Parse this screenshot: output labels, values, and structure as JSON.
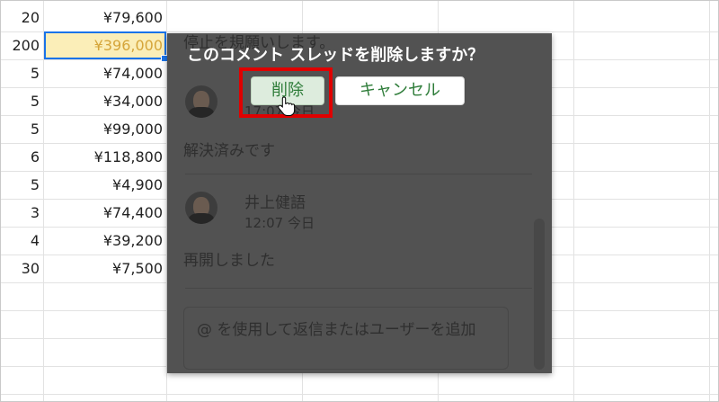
{
  "sheet": {
    "rows": [
      {
        "qty": "20",
        "amount": "¥79,600"
      },
      {
        "qty": "200",
        "amount": "¥396,000"
      },
      {
        "qty": "5",
        "amount": "¥74,000"
      },
      {
        "qty": "5",
        "amount": "¥34,000"
      },
      {
        "qty": "5",
        "amount": "¥99,000"
      },
      {
        "qty": "6",
        "amount": "¥118,800"
      },
      {
        "qty": "5",
        "amount": "¥4,900"
      },
      {
        "qty": "3",
        "amount": "¥74,400"
      },
      {
        "qty": "4",
        "amount": "¥39,200"
      },
      {
        "qty": "30",
        "amount": "¥7,500"
      }
    ],
    "selected_row": 1
  },
  "comment_panel": {
    "partial_top_text": "停止を規願いします。",
    "first_comment": {
      "time_partial": "17:07 今日",
      "body": "解決済みです"
    },
    "second_comment": {
      "author": "井上健語",
      "time": "12:07 今日",
      "body": "再開しました"
    },
    "reply_placeholder": "@ を使用して返信またはユーザーを追加"
  },
  "confirm_dialog": {
    "title": "このコメント スレッドを削除しますか？",
    "delete_label": "削除",
    "cancel_label": "キャンセル"
  },
  "colors": {
    "selection_border": "#1a73e8",
    "selection_fill": "#fbeeb8",
    "highlight_box": "#e00000",
    "button_text": "#2f7d3a",
    "overlay": "#525252"
  },
  "icons": {
    "cursor": "hand-pointer-icon",
    "avatar": "user-avatar"
  }
}
